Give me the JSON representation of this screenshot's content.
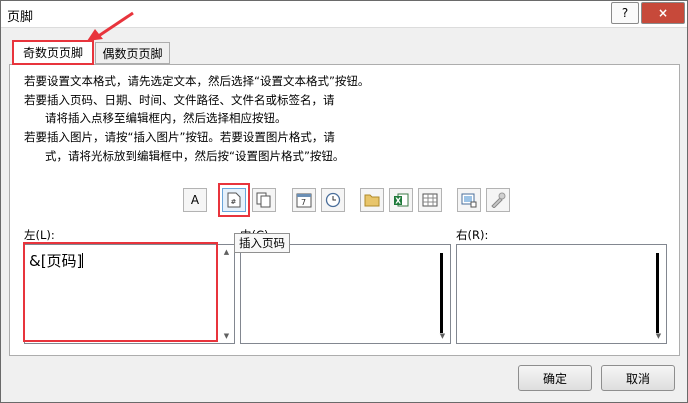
{
  "window": {
    "title": "页脚",
    "help_label": "?",
    "close_label": "×"
  },
  "tabs": [
    {
      "label": "奇数页页脚",
      "active": true
    },
    {
      "label": "偶数页页脚",
      "active": false
    }
  ],
  "instructions": [
    "若要设置文本格式，请先选定文本，然后选择“设置文本格式”按钮。",
    "若要插入页码、日期、时间、文件路径、文件名或标签名，请",
    "请将插入点移至编辑框内，然后选择相应按钮。",
    "若要插入图片，请按“插入图片”按钮。若要设置图片格式，请",
    "式，请将光标放到编辑框中，然后按“设置图片格式”按钮。"
  ],
  "toolbar": {
    "format_text_label": "A",
    "page_number_glyph": "#",
    "date_day": "7",
    "excel_letter": "X",
    "tooltip": "插入页码"
  },
  "sections": {
    "left": {
      "label": "左(L):",
      "value": "&[页码]"
    },
    "center": {
      "label": "中(C):",
      "value": ""
    },
    "right": {
      "label": "右(R):",
      "value": ""
    }
  },
  "buttons": {
    "ok": "确定",
    "cancel": "取消"
  },
  "colors": {
    "highlight": "#e8343c",
    "close": "#c7493a"
  }
}
